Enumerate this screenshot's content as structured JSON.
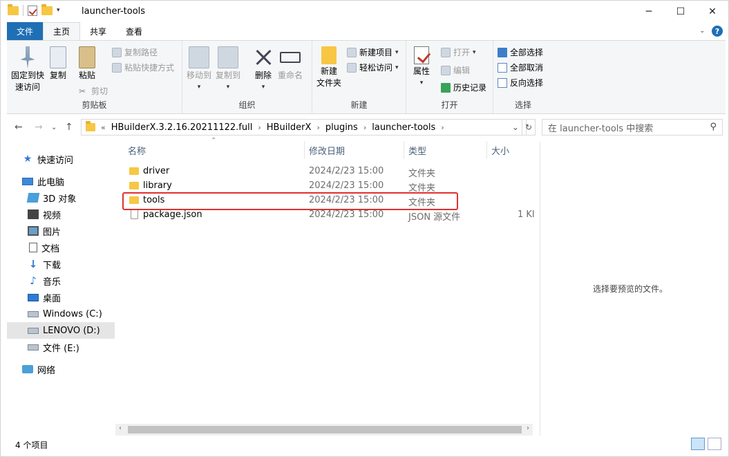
{
  "window": {
    "title": "launcher-tools",
    "controls": {
      "minimize": "─",
      "maximize": "☐",
      "close": "✕"
    }
  },
  "ribbon_tabs": [
    "文件",
    "主页",
    "共享",
    "查看"
  ],
  "ribbon": {
    "clipboard": {
      "label": "剪贴板",
      "pin": "固定到快\n速访问",
      "pin_line1": "固定到快",
      "pin_line2": "速访问",
      "copy": "复制",
      "paste": "粘贴",
      "copy_path": "复制路径",
      "paste_shortcut": "粘贴快捷方式",
      "cut": "剪切"
    },
    "organize": {
      "label": "组织",
      "move_to": "移动到",
      "copy_to": "复制到",
      "delete": "删除",
      "rename": "重命名"
    },
    "new": {
      "label": "新建",
      "new_folder_line1": "新建",
      "new_folder_line2": "文件夹",
      "new_item": "新建项目",
      "easy_access": "轻松访问"
    },
    "open": {
      "label": "打开",
      "properties": "属性",
      "open": "打开",
      "edit": "编辑",
      "history": "历史记录"
    },
    "select": {
      "label": "选择",
      "select_all": "全部选择",
      "select_none": "全部取消",
      "invert": "反向选择"
    }
  },
  "address": {
    "prefix": "«",
    "crumbs": [
      "HBuilderX.3.2.16.20211122.full",
      "HBuilderX",
      "plugins",
      "launcher-tools"
    ],
    "search_placeholder": "在 launcher-tools 中搜索"
  },
  "nav": {
    "quick_access": "快速访问",
    "this_pc": "此电脑",
    "items": [
      "3D 对象",
      "视频",
      "图片",
      "文档",
      "下载",
      "音乐",
      "桌面",
      "Windows (C:)",
      "LENOVO (D:)",
      "文件 (E:)"
    ],
    "network": "网络"
  },
  "columns": {
    "name": "名称",
    "date": "修改日期",
    "type": "类型",
    "size": "大小"
  },
  "files": [
    {
      "name": "driver",
      "date": "2024/2/23 15:00",
      "type": "文件夹",
      "size": ""
    },
    {
      "name": "library",
      "date": "2024/2/23 15:00",
      "type": "文件夹",
      "size": ""
    },
    {
      "name": "tools",
      "date": "2024/2/23 15:00",
      "type": "文件夹",
      "size": ""
    },
    {
      "name": "package.json",
      "date": "2024/2/23 15:00",
      "type": "JSON 源文件",
      "size": "1 KI"
    }
  ],
  "preview": {
    "empty_text": "选择要预览的文件。"
  },
  "status": {
    "count": "4 个项目"
  }
}
